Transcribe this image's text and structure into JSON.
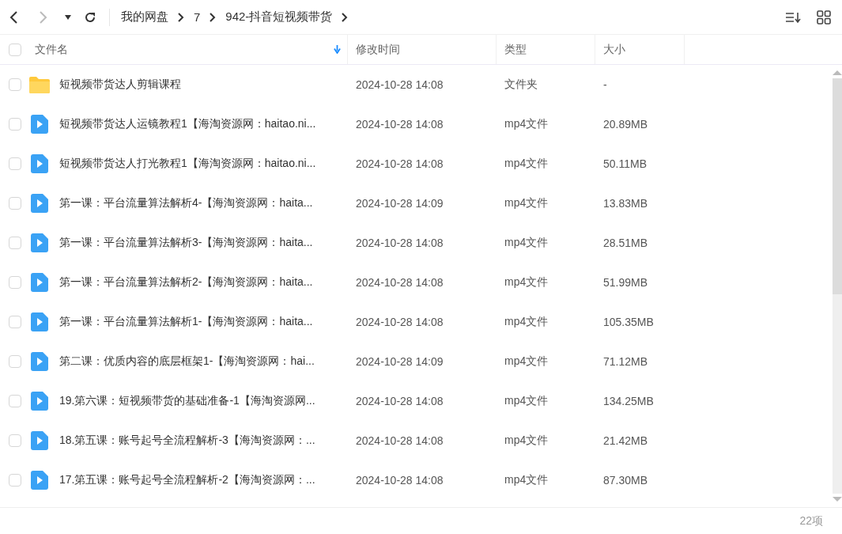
{
  "toolbar": {
    "breadcrumb": [
      "我的网盘",
      "7",
      "942-抖音短视频带货"
    ]
  },
  "table": {
    "select_all": {
      "checked": false
    },
    "columns": [
      {
        "label": "文件名",
        "sorted": true
      },
      {
        "label": "修改时间",
        "sorted": false
      },
      {
        "label": "类型",
        "sorted": false
      },
      {
        "label": "大小",
        "sorted": false
      }
    ],
    "rows": [
      {
        "kind": "folder",
        "checked": false,
        "name": "短视频带货达人剪辑课程",
        "time": "2024-10-28 14:08",
        "type": "文件夹",
        "size": "-"
      },
      {
        "kind": "video",
        "checked": false,
        "name": "短视频带货达人运镜教程1【海淘资源网：haitao.ni...",
        "time": "2024-10-28 14:08",
        "type": "mp4文件",
        "size": "20.89MB"
      },
      {
        "kind": "video",
        "checked": false,
        "name": "短视频带货达人打光教程1【海淘资源网：haitao.ni...",
        "time": "2024-10-28 14:08",
        "type": "mp4文件",
        "size": "50.11MB"
      },
      {
        "kind": "video",
        "checked": false,
        "name": "第一课：平台流量算法解析4-【海淘资源网：haita...",
        "time": "2024-10-28 14:09",
        "type": "mp4文件",
        "size": "13.83MB"
      },
      {
        "kind": "video",
        "checked": false,
        "name": "第一课：平台流量算法解析3-【海淘资源网：haita...",
        "time": "2024-10-28 14:08",
        "type": "mp4文件",
        "size": "28.51MB"
      },
      {
        "kind": "video",
        "checked": false,
        "name": "第一课：平台流量算法解析2-【海淘资源网：haita...",
        "time": "2024-10-28 14:08",
        "type": "mp4文件",
        "size": "51.99MB"
      },
      {
        "kind": "video",
        "checked": false,
        "name": "第一课：平台流量算法解析1-【海淘资源网：haita...",
        "time": "2024-10-28 14:08",
        "type": "mp4文件",
        "size": "105.35MB"
      },
      {
        "kind": "video",
        "checked": false,
        "name": "第二课：优质内容的底层框架1-【海淘资源网：hai...",
        "time": "2024-10-28 14:09",
        "type": "mp4文件",
        "size": "71.12MB"
      },
      {
        "kind": "video",
        "checked": false,
        "name": "19.第六课：短视频带货的基础准备-1【海淘资源网...",
        "time": "2024-10-28 14:08",
        "type": "mp4文件",
        "size": "134.25MB"
      },
      {
        "kind": "video",
        "checked": false,
        "name": "18.第五课：账号起号全流程解析-3【海淘资源网：...",
        "time": "2024-10-28 14:08",
        "type": "mp4文件",
        "size": "21.42MB"
      },
      {
        "kind": "video",
        "checked": false,
        "name": "17.第五课：账号起号全流程解析-2【海淘资源网：...",
        "time": "2024-10-28 14:08",
        "type": "mp4文件",
        "size": "87.30MB"
      }
    ]
  },
  "status_bar": {
    "count": "22项"
  }
}
